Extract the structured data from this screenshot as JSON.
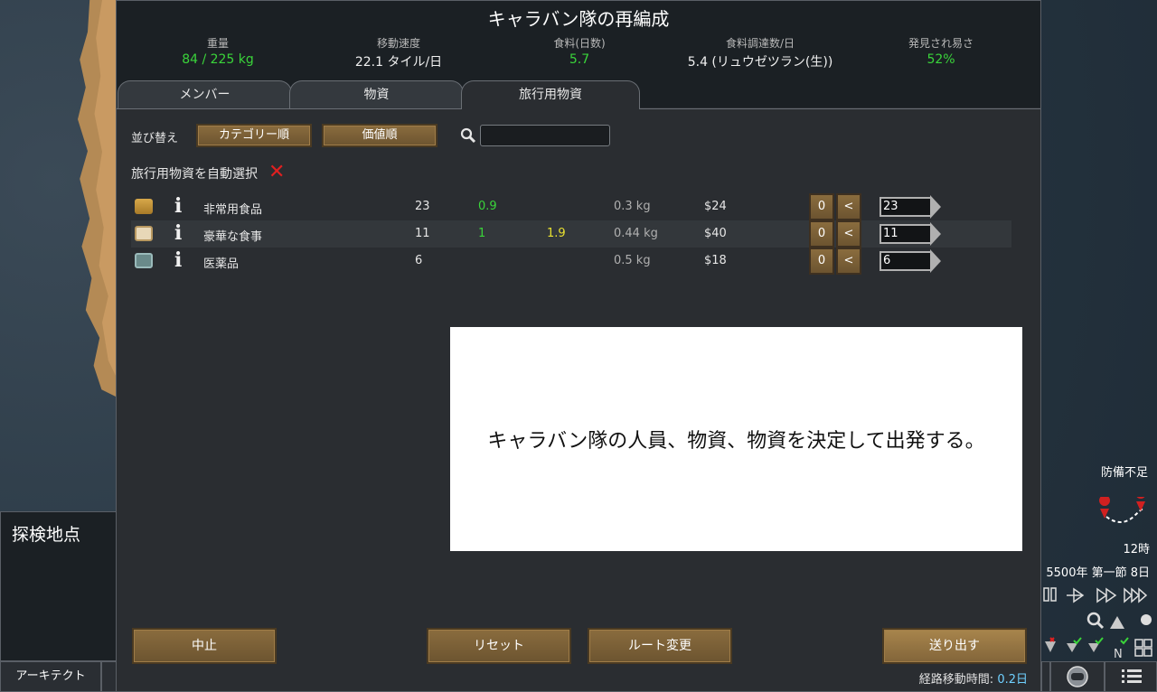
{
  "dialog": {
    "title": "キャラバン隊の再編成",
    "stats": [
      {
        "label": "重量",
        "value": "84 / 225 kg",
        "color": "#3ad43a"
      },
      {
        "label": "移動速度",
        "value": "22.1 タイル/日",
        "color": "#f0f0f0"
      },
      {
        "label": "食料(日数)",
        "value": "5.7",
        "color": "#3ad43a"
      },
      {
        "label": "食料調達数/日",
        "value": "5.4 (リュウゼツラン(生))",
        "color": "#f0f0f0"
      },
      {
        "label": "発見され易さ",
        "value": "52%",
        "color": "#3ad43a"
      }
    ],
    "tabs": [
      "メンバー",
      "物資",
      "旅行用物資"
    ],
    "active_tab": "旅行用物資",
    "sort": {
      "label": "並び替え",
      "category_button": "カテゴリー順",
      "value_button": "価値順",
      "search_value": ""
    },
    "auto_select_label": "旅行用物資を自動選択",
    "items": [
      {
        "name": "非常用食品",
        "count": "23",
        "nutrition": "0.9",
        "days": "",
        "mass": "0.3 kg",
        "price": "$24",
        "zero": "0",
        "less": "<",
        "qty": "23",
        "icon": "packaged-survival-meal-icon"
      },
      {
        "name": "豪華な食事",
        "count": "11",
        "nutrition": "1",
        "days": "1.9",
        "mass": "0.44 kg",
        "price": "$40",
        "zero": "0",
        "less": "<",
        "qty": "11",
        "icon": "fine-meal-icon"
      },
      {
        "name": "医薬品",
        "count": "6",
        "nutrition": "",
        "days": "",
        "mass": "0.5 kg",
        "price": "$18",
        "zero": "0",
        "less": "<",
        "qty": "6",
        "icon": "medicine-icon"
      }
    ],
    "overlay_text": "キャラバン隊の人員、物資、物資を決定して出発する。",
    "buttons": {
      "cancel": "中止",
      "reset": "リセット",
      "change_route": "ルート変更",
      "send": "送り出す"
    },
    "travel_time_label": "経路移動時間:",
    "travel_time_value": "0.2日"
  },
  "left_panel": {
    "title": "探検地点",
    "architect_tab": "アーキテクト"
  },
  "hud": {
    "defense": "防備不足",
    "hour": "12時",
    "date": "5500年 第一節 8日"
  },
  "colors": {
    "green": "#3ad43a",
    "yellow": "#e8e030",
    "button": "#7a603a"
  }
}
